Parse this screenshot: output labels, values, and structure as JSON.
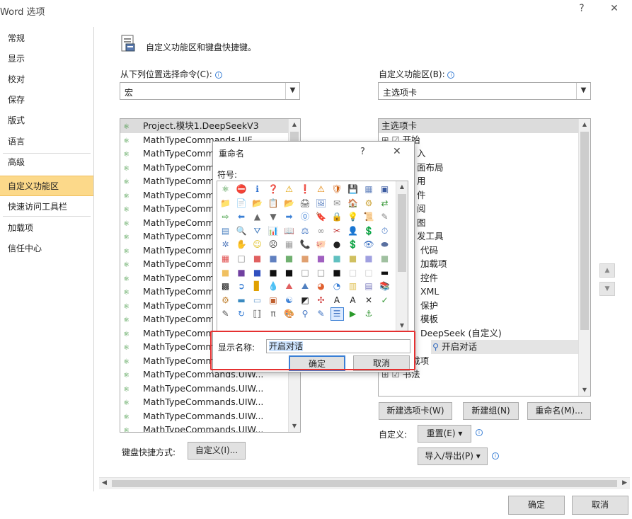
{
  "window": {
    "title": "Word 选项",
    "help": "?",
    "close": "✕"
  },
  "nav": {
    "items": [
      "常规",
      "显示",
      "校对",
      "保存",
      "版式",
      "语言",
      "高级",
      "自定义功能区",
      "快速访问工具栏",
      "加载项",
      "信任中心"
    ],
    "active_index": 7
  },
  "header": {
    "title": "自定义功能区和键盘快捷键。"
  },
  "left_pane": {
    "label": "从下列位置选择命令(C):",
    "combo_value": "宏",
    "items": [
      "Project.模块1.DeepSeekV3",
      "MathTypeCommands.UIF",
      "MathTypeComm",
      "MathTypeComm",
      "MathTypeComm",
      "MathTypeComm",
      "MathTypeComm",
      "MathTypeComm",
      "MathTypeComm",
      "MathTypeComm",
      "MathTypeComm",
      "MathTypeComm",
      "MathTypeComm",
      "MathTypeComm",
      "MathTypeComm",
      "MathTypeComm",
      "MathTypeComm",
      "MathTypeComm",
      "MathTypeCommands.UIW...",
      "MathTypeCommands.UIW...",
      "MathTypeCommands.UIW...",
      "MathTypeCommands.UIW...",
      "MathTypeCommands.UIW..."
    ]
  },
  "right_pane": {
    "label": "自定义功能区(B):",
    "combo_value": "主选项卡",
    "items": [
      {
        "text": "主选项卡",
        "prefix": "",
        "indent": 0,
        "sel": true
      },
      {
        "text": "开始",
        "prefix": "⊞ ☑",
        "indent": 0
      },
      {
        "text": "入",
        "prefix": "",
        "indent": 50
      },
      {
        "text": "面布局",
        "prefix": "",
        "indent": 50
      },
      {
        "text": "用",
        "prefix": "",
        "indent": 50
      },
      {
        "text": "件",
        "prefix": "",
        "indent": 50
      },
      {
        "text": "阅",
        "prefix": "",
        "indent": 50
      },
      {
        "text": "图",
        "prefix": "",
        "indent": 50
      },
      {
        "text": "发工具",
        "prefix": "",
        "indent": 50
      },
      {
        "text": "代码",
        "prefix": "",
        "indent": 55
      },
      {
        "text": "加载项",
        "prefix": "",
        "indent": 55
      },
      {
        "text": "控件",
        "prefix": "",
        "indent": 55
      },
      {
        "text": "XML",
        "prefix": "",
        "indent": 55
      },
      {
        "text": "保护",
        "prefix": "",
        "indent": 55
      },
      {
        "text": "模板",
        "prefix": "",
        "indent": 55
      },
      {
        "text": "DeepSeek (自定义)",
        "prefix": "",
        "indent": 55
      },
      {
        "text": "开启对话",
        "prefix": "⚲",
        "indent": 70,
        "hl": true
      },
      {
        "text": "加载项",
        "prefix": "⊞ ☑",
        "indent": 0
      },
      {
        "text": "书法",
        "prefix": "⊞ ☑",
        "indent": 0
      }
    ],
    "btn_new_tab": "新建选项卡(W)",
    "btn_new_group": "新建组(N)",
    "btn_rename": "重命名(M)...",
    "customize_label": "自定义:",
    "btn_reset": "重置(E) ▾",
    "btn_import_export": "导入/导出(P) ▾"
  },
  "shortcut": {
    "label": "键盘快捷方式:",
    "button": "自定义(I)..."
  },
  "footer": {
    "ok": "确定",
    "cancel": "取消"
  },
  "rename_dialog": {
    "title": "重命名",
    "help": "?",
    "close": "✕",
    "symbol_label": "符号:",
    "display_name_label": "显示名称:",
    "display_name_value": "开启对话",
    "ok": "确定",
    "cancel": "取消",
    "symbols": [
      "⚛",
      "⛔",
      "ℹ",
      "❓",
      "⚠",
      "❗",
      "⚠",
      "🛡",
      "💾",
      "▦",
      "▣",
      "📁",
      "📄",
      "📂",
      "📋",
      "📂",
      "🖨",
      "🖼",
      "✉",
      "🏠",
      "⚙",
      "⇄",
      "⇨",
      "⬅",
      "▲",
      "▼",
      "➡",
      "⓪",
      "🔖",
      "🔒",
      "💡",
      "📜",
      "✎",
      "▤",
      "🔍",
      "⛛",
      "📊",
      "📖",
      "⚖",
      "∞",
      "✂",
      "👤",
      "💲",
      "⏱",
      "✲",
      "✋",
      "☺",
      "☹",
      "▦",
      "📞",
      "🐖",
      "●",
      "💲",
      "👁",
      "⬬",
      "▦",
      "□",
      "■",
      "■",
      "■",
      "■",
      "■",
      "■",
      "■",
      "■",
      "■",
      "■",
      "■",
      "■",
      "■",
      "■",
      "□",
      "□",
      "■",
      "□",
      "□",
      "▬",
      "▩",
      "➲",
      "▊",
      "💧",
      "⛰",
      "⛰",
      "◕",
      "◔",
      "▥",
      "▤",
      "📚",
      "⚙",
      "▬",
      "▭",
      "▣",
      "☯",
      "◩",
      "✣",
      "A",
      "A",
      "✕",
      "✓",
      "✎",
      "↻",
      "⟦⟧",
      "π",
      "🎨",
      "⚲",
      "✎",
      "☰",
      "▶",
      "⚓"
    ],
    "sym_colors": [
      "#2b8a2b",
      "#d23",
      "#2a6fd0",
      "#3a6fc0",
      "#e0a000",
      "#d22",
      "#e08000",
      "#d06010",
      "#2a5aa0",
      "#6a88c0",
      "#3a5aa0",
      "#e0b040",
      "#ccc",
      "#d0a030",
      "#d8c060",
      "#d0a030",
      "#555",
      "#5a80c0",
      "#888",
      "#c06030",
      "#caa030",
      "#3a9a3a",
      "#3a9a3a",
      "#3a7fd5",
      "#666",
      "#666",
      "#3a7fd5",
      "#3a7fd5",
      "#c0a040",
      "#c09020",
      "#e0c020",
      "#c0a060",
      "#888",
      "#4a80c0",
      "#666",
      "#4a80c0",
      "#4a80c0",
      "#3a6fc0",
      "#3a6fc0",
      "#888",
      "#c03030",
      "#8a6a40",
      "#3a7a3a",
      "#3a6fc0",
      "#5a80c0",
      "#e0b040",
      "#e0c020",
      "#333",
      "#999",
      "#666",
      "#c070a0",
      "#222",
      "#222",
      "#3a6fc0",
      "#5a70a0",
      "#e05050",
      "#888",
      "#e06060",
      "#6080c0",
      "#70b070",
      "#e0a070",
      "#a060c0",
      "#60c0c0",
      "#d0c060",
      "#a0a0e0",
      "#a0c0a0",
      "#f0c060",
      "#7040a0",
      "#3050c0",
      "#111",
      "#111",
      "#888",
      "#888",
      "#111",
      "#ccc",
      "#ccc",
      "#111",
      "#111",
      "#3a7fd5",
      "#e0a000",
      "#3a7fd5",
      "#e06060",
      "#5080c0",
      "#e06030",
      "#3a7fd5",
      "#e0c050",
      "#8080c0",
      "#e0a040",
      "#c08030",
      "#3a8ac0",
      "#70a0d0",
      "#c06030",
      "#3a7fd5",
      "#222",
      "#d04040",
      "#222",
      "#222",
      "#333",
      "#3a9a3a",
      "#555",
      "#3a7fd5",
      "#555",
      "#555",
      "#c0a040",
      "#3a6fc0",
      "#3a6fc0",
      "#3a6fc0",
      "#2a9a2a",
      "#3a9a3a"
    ]
  }
}
